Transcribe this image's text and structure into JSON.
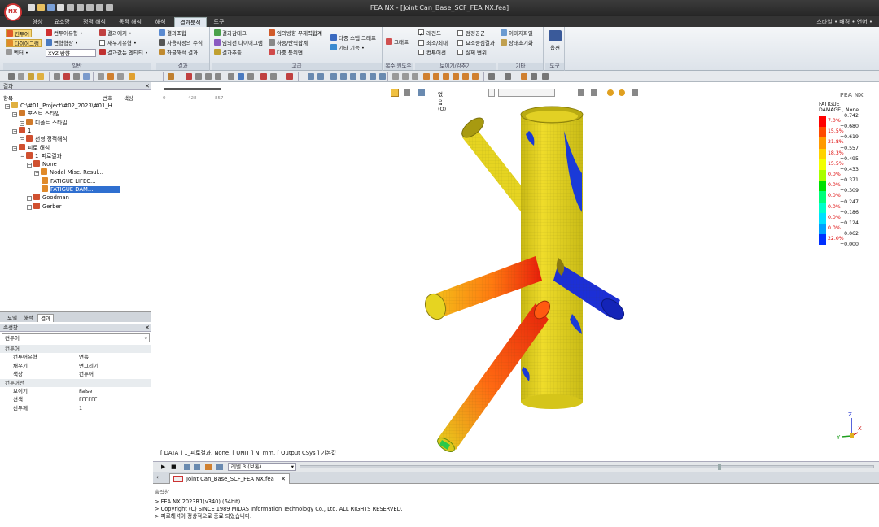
{
  "app": {
    "logo_text": "NX",
    "window_title": "FEA NX - [Joint Can_Base_SCF_FEA NX.fea]"
  },
  "menu": {
    "tabs": [
      "형상",
      "요소망",
      "정적 해석",
      "동적 해석",
      "해석",
      "결과분석",
      "도구"
    ],
    "active_index": 5,
    "right": "스타일 • 배경 • 언어 •"
  },
  "ribbon": {
    "groups": {
      "general": "일반",
      "result": "결과",
      "advanced": "고급",
      "multi_window": "복수 윈도우",
      "show_hide": "보이기/감추기",
      "misc": "기타",
      "tools": "도구"
    },
    "general_items": [
      "컨투어",
      "컨투어유형 •",
      "결과에지 •",
      "다이어그램",
      "변형형상 •",
      "재우기유형 •",
      "벡터 •",
      "XYZ 방향",
      "결과값는 엔티티 •"
    ],
    "result_items": [
      "결과조합",
      "사용자정의 수식",
      "좌굴해석 결과"
    ],
    "advanced_items": [
      "결과감태그",
      "임의방향 부재력합계",
      "다중 스텝 그래프",
      "임의선 다이어그램",
      "하중/반력합계",
      "결과추출",
      "다중 등위면",
      "기타 기능 •"
    ],
    "graph_label": "그래프",
    "show_items": [
      "레전드",
      "점정공군",
      "최소/최대",
      "요소중심결과",
      "컨투어선",
      "실제 변위"
    ],
    "show_checked": [
      true,
      false,
      false,
      false,
      false,
      false
    ],
    "misc_items": [
      "이미지파일",
      "상태초기화"
    ],
    "tools_label": "옵션"
  },
  "result_panel": {
    "title": "결과",
    "columns": [
      "항목",
      "번호",
      "색상"
    ],
    "tree": [
      {
        "label": "C:\\#01_Project\\#02_2023\\#01_H...",
        "level": 0,
        "icon": "folder"
      },
      {
        "label": "포스트 스타일",
        "level": 1,
        "icon": "style"
      },
      {
        "label": "디폴트 스타일",
        "level": 2,
        "icon": "style"
      },
      {
        "label": "1",
        "level": 1,
        "icon": "case"
      },
      {
        "label": "선형 정적해석",
        "level": 2,
        "icon": "case"
      },
      {
        "label": "피로 해석",
        "level": 1,
        "icon": "case"
      },
      {
        "label": "1_피로결과",
        "level": 2,
        "icon": "case"
      },
      {
        "label": "None",
        "level": 3,
        "icon": "case"
      },
      {
        "label": "Nodal Misc. Resul...",
        "level": 4,
        "icon": "result"
      },
      {
        "label": "FATIGUE LIFEC...",
        "level": 5,
        "icon": "result"
      },
      {
        "label": "FATIGUE DAM...",
        "level": 5,
        "icon": "result",
        "selected": true
      },
      {
        "label": "Goodman",
        "level": 3,
        "icon": "case"
      },
      {
        "label": "Gerber",
        "level": 3,
        "icon": "case"
      }
    ]
  },
  "left_tabs": [
    "모델",
    "해석",
    "결과"
  ],
  "left_tabs_active": 2,
  "property_panel": {
    "title": "속성창",
    "selector": "컨투어",
    "rows": [
      {
        "type": "cat",
        "key": "컨투어"
      },
      {
        "type": "row",
        "key": "컨투어유형",
        "value": "연속"
      },
      {
        "type": "row",
        "key": "채우기",
        "value": "면그리기"
      },
      {
        "type": "row",
        "key": "색상",
        "value": "컨투어"
      },
      {
        "type": "cat",
        "key": "컨투어선"
      },
      {
        "type": "row",
        "key": "보이기",
        "value": "False"
      },
      {
        "type": "row",
        "key": "선색",
        "value": "FFFFFF"
      },
      {
        "type": "row",
        "key": "선두께",
        "value": "1"
      }
    ]
  },
  "viewport": {
    "scale_ticks": [
      "0",
      "428",
      "857"
    ],
    "view_option": "없음 (O)",
    "brand": "FEA NX",
    "data_line": "[ DATA ] 1_피로결과, None, [ UNIT ] N, mm, [ Output CSys ] 기본값",
    "axes": {
      "x": "X",
      "y": "Y",
      "z": "Z"
    }
  },
  "legend": {
    "title_line1": "FATIGUE",
    "title_line2": "DAMAGE , None",
    "values": [
      "+0.742",
      "+0.680",
      "+0.619",
      "+0.557",
      "+0.495",
      "+0.433",
      "+0.371",
      "+0.309",
      "+0.247",
      "+0.186",
      "+0.124",
      "+0.062",
      "+0.000"
    ],
    "percents": [
      "7.0%",
      "15.5%",
      "21.8%",
      "18.3%",
      "15.5%",
      "0.0%",
      "0.0%",
      "0.0%",
      "0.0%",
      "0.0%",
      "0.0%",
      "22.0%"
    ],
    "colors": [
      "#ff0000",
      "#ff4a00",
      "#ff9a00",
      "#ffd200",
      "#f2ff00",
      "#a8ff00",
      "#00e000",
      "#00ff7a",
      "#00ffcc",
      "#00e0ff",
      "#00a0ff",
      "#0030ff"
    ]
  },
  "anim_bar": {
    "speed_label": "레벨 3 (보통)"
  },
  "doc_tab": "Joint Can_Base_SCF_FEA NX.fea",
  "output": {
    "title": "출력창",
    "lines": [
      "> FEA NX 2023R1(v340) (64bit)",
      "> Copyright (C) SINCE 1989 MIDAS Information Technology Co., Ltd. ALL RIGHTS RESERVED.",
      "> 피로해석이 정상적으로 종료 되었습니다."
    ]
  },
  "colors": {
    "title_bar": "#2e2e2e",
    "selection": "#2f6fd0",
    "cylinder_base": "#e3cf1e"
  }
}
